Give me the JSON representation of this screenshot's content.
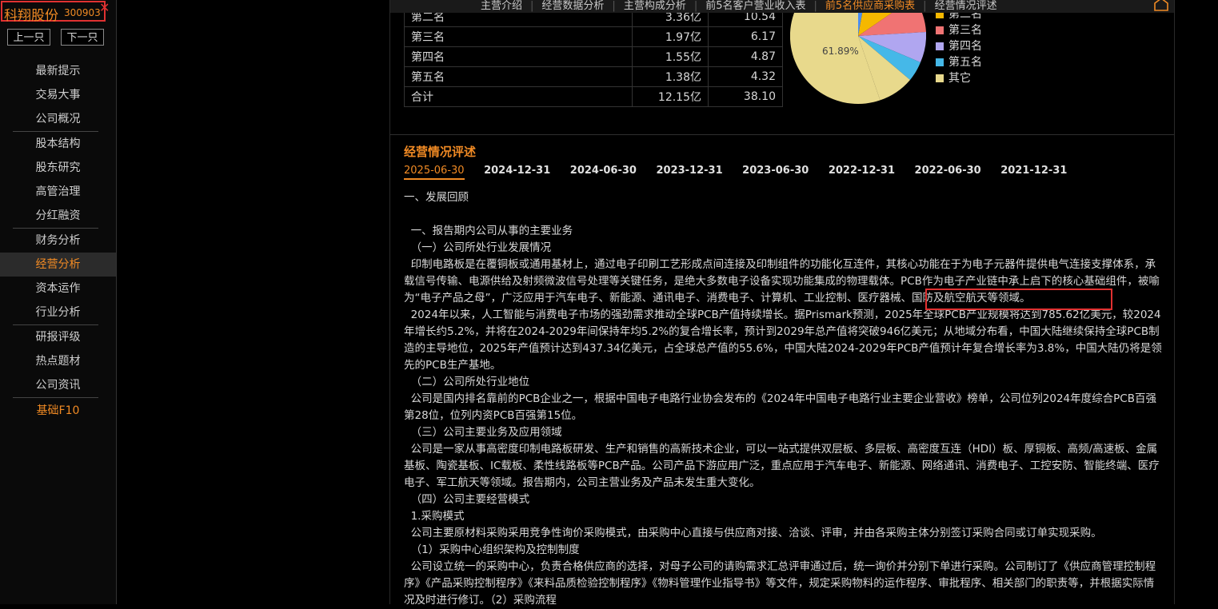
{
  "stock": {
    "name": "科翔股份",
    "code": "300903",
    "close_glyph": "✕"
  },
  "nav": {
    "prev_label": "上一只",
    "next_label": "下一只"
  },
  "menu": {
    "group1": [
      "最新提示",
      "交易大事",
      "公司概况"
    ],
    "group2": [
      "股本结构",
      "股东研究",
      "高管治理",
      "分红融资"
    ],
    "group3": [
      "财务分析",
      "经营分析",
      "资本运作",
      "行业分析"
    ],
    "group4": [
      "研报评级",
      "热点题材",
      "公司资讯"
    ],
    "group5": [
      "基础F10"
    ],
    "active": "经营分析"
  },
  "tabs": [
    "主营介绍",
    "经营数据分析",
    "主营构成分析",
    "前5名客户营业收入表",
    "前5名供应商采购表",
    "经营情况评述"
  ],
  "active_tab": "前5名供应商采购表",
  "supplier_table": {
    "rows": [
      [
        "第二名",
        "3.36亿",
        "10.54"
      ],
      [
        "第三名",
        "1.97亿",
        "6.17"
      ],
      [
        "第四名",
        "1.55亿",
        "4.87"
      ],
      [
        "第五名",
        "1.38亿",
        "4.32"
      ],
      [
        "合计",
        "12.15亿",
        "38.10"
      ]
    ]
  },
  "pie": {
    "label": "61.89%",
    "colors": {
      "other": "#e8d98c",
      "second": "#f5b800",
      "third": "#f07373",
      "fourth": "#b0a6f0",
      "fifth": "#45b8e8",
      "first": "#4a8ef0"
    }
  },
  "legend": {
    "items": [
      {
        "label": "第二名",
        "color": "#f5b800"
      },
      {
        "label": "第三名",
        "color": "#f07373"
      },
      {
        "label": "第四名",
        "color": "#b0a6f0"
      },
      {
        "label": "第五名",
        "color": "#45b8e8"
      },
      {
        "label": "其它",
        "color": "#e8d98c"
      }
    ]
  },
  "section": {
    "title": "经营情况评述",
    "dates": [
      "2025-06-30",
      "2024-12-31",
      "2024-06-30",
      "2023-12-31",
      "2023-06-30",
      "2022-12-31",
      "2022-06-30",
      "2021-12-31"
    ],
    "active_date": "2025-06-30"
  },
  "article": {
    "h1": "一、发展回顾",
    "blank": "",
    "p1": "  一、报告期内公司从事的主要业务",
    "p2": "  （一）公司所处行业发展情况",
    "p3": "  印制电路板是在覆铜板或通用基材上，通过电子印刷工艺形成点间连接及印制组件的功能化互连件，其核心功能在于为电子元器件提供电气连接支撑体系，承载信号传输、电源供给及射频微波信号处理等关键任务，是绝大多数电子设备实现功能集成的物理载体。PCB作为电子产业链中承上启下的核心基础组件，被喻为“电子产品之母”，广泛应用于汽车电子、新能源、通讯电子、消费电子、计算机、工业控制、医疗器械、国防及航空航天等领域。",
    "p4": "  2024年以来，人工智能与消费电子市场的强劲需求推动全球PCB产值持续增长。据Prismark预测，2025年全球PCB产业规模将达到785.62亿美元，较2024年增长约5.2%，并将在2024-2029年间保持年均5.2%的复合增长率，预计到2029年总产值将突破946亿美元；从地域分布看，中国大陆继续保持全球PCB制造的主导地位，2025年产值预计达到437.34亿美元，占全球总产值的55.6%，中国大陆2024-2029年PCB产值预计年复合增长率为3.8%，中国大陆仍将是领先的PCB生产基地。",
    "p5": "  （二）公司所处行业地位",
    "p6": "  公司是国内排名靠前的PCB企业之一，根据中国电子电路行业协会发布的《2024年中国电子电路行业主要企业营收》榜单，公司位列2024年度综合PCB百强第28位，位列内资PCB百强第15位。",
    "p7": "  （三）公司主要业务及应用领域",
    "p8": "  公司是一家从事高密度印制电路板研发、生产和销售的高新技术企业，可以一站式提供双层板、多层板、高密度互连（HDI）板、厚铜板、高频/高速板、金属基板、陶瓷基板、IC载板、柔性线路板等PCB产品。公司产品下游应用广泛，重点应用于汽车电子、新能源、网络通讯、消费电子、工控安防、智能终端、医疗电子、军工航天等领域。报告期内，公司主营业务及产品未发生重大变化。",
    "p9": "  （四）公司主要经营模式",
    "p10": "  1.采购模式",
    "p11": "  公司主要原材料采购采用竞争性询价采购模式，由采购中心直接与供应商对接、洽谈、评审，并由各采购主体分别签订采购合同或订单实现采购。",
    "p12": "  （1）采购中心组织架构及控制制度",
    "p13": "  公司设立统一的采购中心，负责合格供应商的选择，对母子公司的请购需求汇总评审通过后，统一询价并分别下单进行采购。公司制订了《供应商管理控制程序》《产品采购控制程序》《来料品质检验控制程序》《物料管理作业指导书》等文件，规定采购物料的运作程序、审批程序、相关部门的职责等，并根据实际情况及时进行修订。（2）采购流程"
  }
}
